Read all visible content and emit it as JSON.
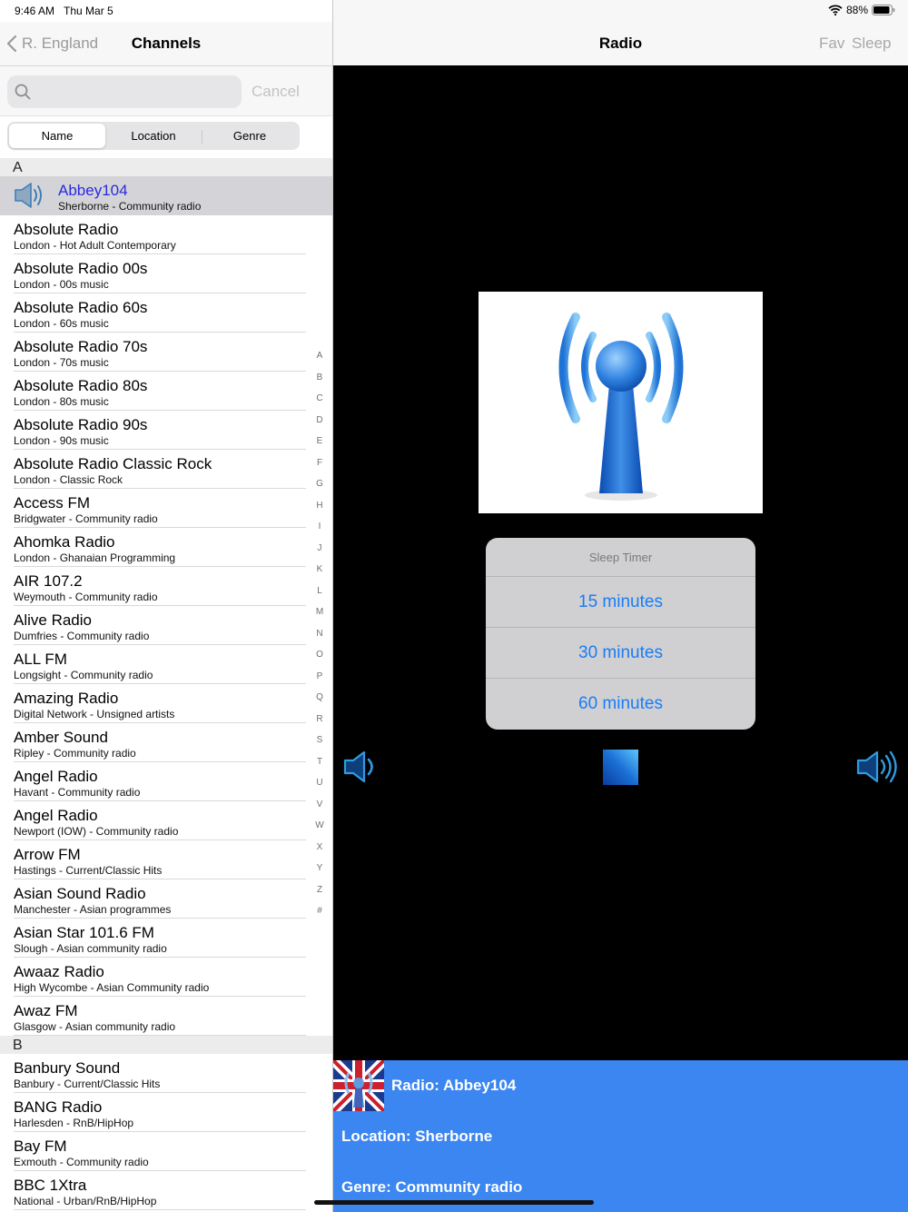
{
  "status": {
    "time": "9:46 AM",
    "date": "Thu Mar 5",
    "battery": "88%"
  },
  "left_nav": {
    "back_label": "R. England",
    "title": "Channels"
  },
  "search": {
    "placeholder": "",
    "cancel_label": "Cancel"
  },
  "segments": [
    {
      "label": "Name",
      "active": true
    },
    {
      "label": "Location",
      "active": false
    },
    {
      "label": "Genre",
      "active": false
    }
  ],
  "sections": [
    {
      "letter": "A",
      "items": [
        {
          "name": "Abbey104",
          "sub": "Sherborne - Community radio",
          "selected": true
        },
        {
          "name": "Absolute Radio",
          "sub": "London - Hot Adult Contemporary"
        },
        {
          "name": "Absolute Radio 00s",
          "sub": "London - 00s music"
        },
        {
          "name": "Absolute Radio 60s",
          "sub": "London - 60s music"
        },
        {
          "name": "Absolute Radio 70s",
          "sub": "London - 70s music"
        },
        {
          "name": "Absolute Radio 80s",
          "sub": "London - 80s music"
        },
        {
          "name": "Absolute Radio 90s",
          "sub": "London - 90s music"
        },
        {
          "name": "Absolute Radio Classic Rock",
          "sub": "London - Classic Rock"
        },
        {
          "name": "Access FM",
          "sub": "Bridgwater - Community radio"
        },
        {
          "name": "Ahomka Radio",
          "sub": "London - Ghanaian Programming"
        },
        {
          "name": "AIR 107.2",
          "sub": "Weymouth - Community radio"
        },
        {
          "name": "Alive Radio",
          "sub": "Dumfries - Community radio"
        },
        {
          "name": "ALL FM",
          "sub": "Longsight - Community radio"
        },
        {
          "name": "Amazing Radio",
          "sub": "Digital Network - Unsigned artists"
        },
        {
          "name": "Amber Sound",
          "sub": "Ripley - Community radio"
        },
        {
          "name": "Angel Radio",
          "sub": "Havant - Community radio"
        },
        {
          "name": "Angel Radio",
          "sub": "Newport (IOW) - Community radio"
        },
        {
          "name": "Arrow FM",
          "sub": "Hastings - Current/Classic Hits"
        },
        {
          "name": "Asian Sound Radio",
          "sub": "Manchester - Asian programmes"
        },
        {
          "name": "Asian Star 101.6 FM",
          "sub": "Slough - Asian community radio"
        },
        {
          "name": "Awaaz Radio",
          "sub": "High Wycombe - Asian Community radio"
        },
        {
          "name": "Awaz FM",
          "sub": "Glasgow - Asian community radio"
        }
      ]
    },
    {
      "letter": "B",
      "items": [
        {
          "name": "Banbury Sound",
          "sub": "Banbury - Current/Classic Hits"
        },
        {
          "name": "BANG Radio",
          "sub": "Harlesden - RnB/HipHop"
        },
        {
          "name": "Bay FM",
          "sub": "Exmouth - Community radio"
        },
        {
          "name": "BBC 1Xtra",
          "sub": "National - Urban/RnB/HipHop"
        }
      ]
    }
  ],
  "index_letters": [
    "A",
    "B",
    "C",
    "D",
    "E",
    "F",
    "G",
    "H",
    "I",
    "J",
    "K",
    "L",
    "M",
    "N",
    "O",
    "P",
    "Q",
    "R",
    "S",
    "T",
    "U",
    "V",
    "W",
    "X",
    "Y",
    "Z",
    "#"
  ],
  "right_nav": {
    "title": "Radio",
    "fav_label": "Fav",
    "sleep_label": "Sleep"
  },
  "sleep_timer": {
    "title": "Sleep Timer",
    "options": [
      "15 minutes",
      "30 minutes",
      "60 minutes"
    ]
  },
  "now_playing": {
    "radio": "Radio: Abbey104",
    "location": "Location: Sherborne",
    "genre": "Genre: Community radio"
  },
  "colors": {
    "accent": "#1a7cf5",
    "info_panel": "#3b86f0",
    "selected_name": "#2a2ae0"
  }
}
